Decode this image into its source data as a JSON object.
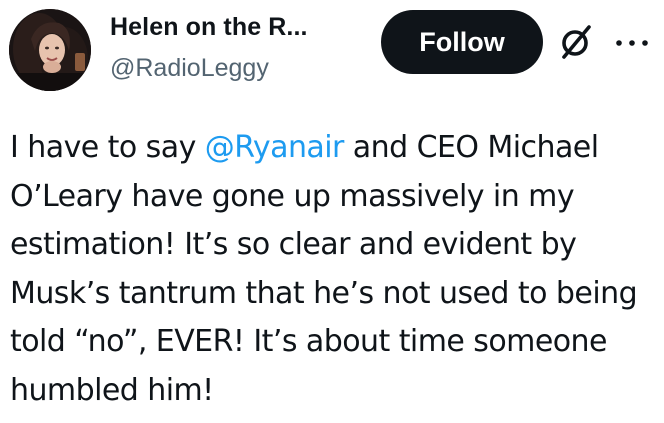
{
  "author": {
    "display_name": "Helen on the R...",
    "handle": "@RadioLeggy",
    "avatar_icon": "profile-photo"
  },
  "actions": {
    "follow_label": "Follow",
    "grok_icon": "grok-slashed-circle-icon",
    "more_icon": "more-horizontal-icon"
  },
  "tweet": {
    "text_before_mention": "I have to say ",
    "mention": "@Ryanair",
    "text_after_mention": " and CEO Michael O’Leary have gone up massively in my estimation! It’s so clear and evident by Musk’s tantrum that he’s not used to being told “no”, EVER! It’s about time someone humbled him!"
  },
  "colors": {
    "text": "#0f1419",
    "secondary": "#536471",
    "link": "#1d9bf0",
    "button_bg": "#0f1419",
    "button_text": "#ffffff"
  }
}
